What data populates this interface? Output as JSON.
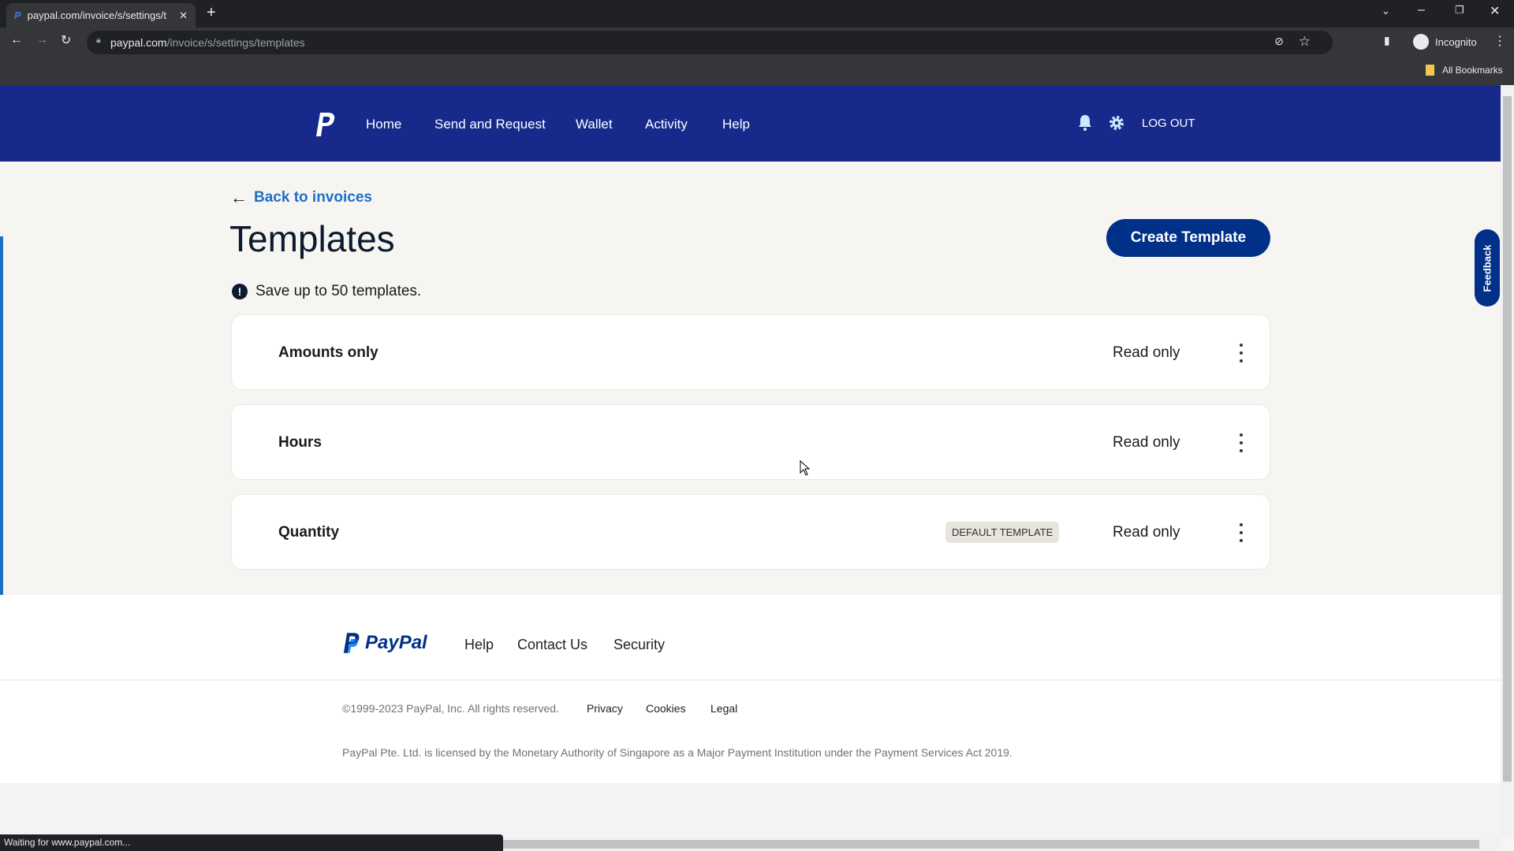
{
  "browser": {
    "tab_title": "paypal.com/invoice/s/settings/t",
    "url_host": "paypal.com",
    "url_path": "/invoice/s/settings/templates",
    "profile_label": "Incognito",
    "bookmarks_label": "All Bookmarks",
    "status_text": "Waiting for www.paypal.com..."
  },
  "nav": {
    "items": [
      "Home",
      "Send and Request",
      "Wallet",
      "Activity",
      "Help"
    ],
    "logout": "LOG OUT",
    "color": "#172a8c"
  },
  "page": {
    "back_link": "Back to invoices",
    "title": "Templates",
    "create_button": "Create Template",
    "info": "Save up to 50 templates.",
    "feedback": "Feedback",
    "templates": [
      {
        "name": "Amounts only",
        "access": "Read only",
        "badge": ""
      },
      {
        "name": "Hours",
        "access": "Read only",
        "badge": ""
      },
      {
        "name": "Quantity",
        "access": "Read only",
        "badge": "DEFAULT TEMPLATE"
      }
    ],
    "accent": "#003087"
  },
  "footer": {
    "logo": "PayPal",
    "links": [
      "Help",
      "Contact Us",
      "Security"
    ],
    "copyright": "©1999-2023 PayPal, Inc. All rights reserved.",
    "legal_links": [
      "Privacy",
      "Cookies",
      "Legal"
    ],
    "license": "PayPal Pte. Ltd. is licensed by the Monetary Authority of Singapore as a Major Payment Institution under the Payment Services Act 2019."
  }
}
